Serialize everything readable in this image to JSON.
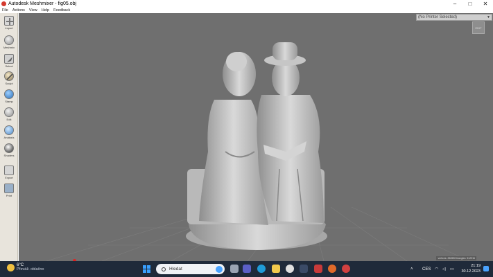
{
  "window": {
    "title": "Autodesk Meshmixer - fig05.obj",
    "controls": {
      "minimize": "–",
      "maximize": "□",
      "close": "✕"
    }
  },
  "menu": [
    "File",
    "Actions",
    "View",
    "Help",
    "Feedback"
  ],
  "toolbar": [
    {
      "label": "Import",
      "icon": "plus-icon"
    },
    {
      "label": "Meshmix",
      "icon": "meshmix-icon"
    },
    {
      "label": "Select",
      "icon": "select-icon"
    },
    {
      "label": "Sculpt",
      "icon": "sculpt-icon"
    },
    {
      "label": "Stamp",
      "icon": "stamp-icon"
    },
    {
      "label": "Edit",
      "icon": "edit-icon"
    },
    {
      "label": "Analysis",
      "icon": "analysis-icon"
    },
    {
      "label": "Shaders",
      "icon": "shaders-icon"
    },
    {
      "label": "Export",
      "icon": "export-icon"
    },
    {
      "label": "Print",
      "icon": "print-icon"
    }
  ],
  "printer_select": "(No Printer Selected)",
  "edit_button": "EDIT",
  "stats": "vertices: 256598 triangles: 512916",
  "taskbar": {
    "weather_temp": "6°C",
    "weather_desc": "Převáž. oblačno",
    "search_placeholder": "Hledat",
    "language": "CES",
    "time": "21:19",
    "date": "30.12.2023"
  }
}
